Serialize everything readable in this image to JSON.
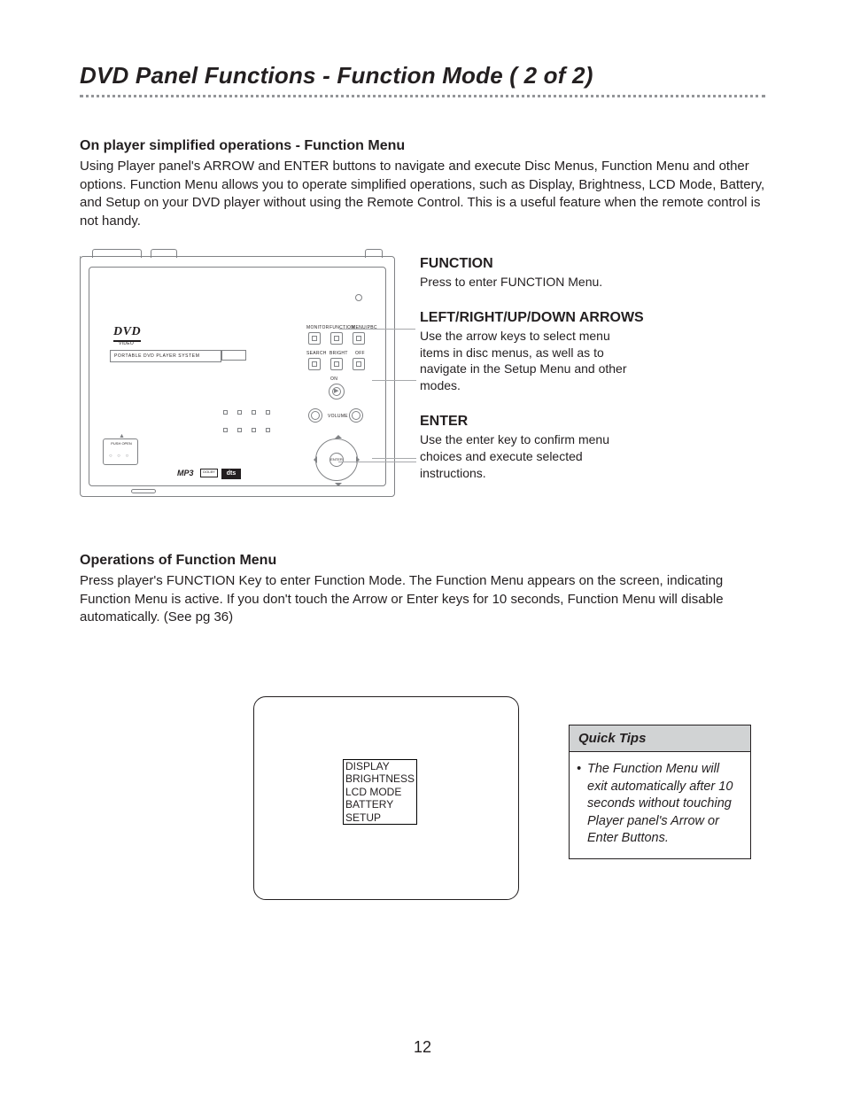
{
  "title": "DVD Panel Functions - Function Mode ( 2 of 2)",
  "section1": {
    "heading": "On player simplified operations - Function Menu",
    "body": "Using Player panel's  ARROW and ENTER buttons to navigate and execute Disc Menus, Function Menu and other options. Function Menu allows you to operate simplified operations, such as Display, Brightness, LCD Mode, Battery, and Setup on your DVD player without using the Remote Control. This is a useful feature when the remote control is not handy."
  },
  "diagram": {
    "dvd_logo": "DVD",
    "dvd_sub": "VIDEO",
    "device_label": "PORTABLE DVD PLAYER SYSTEM",
    "btn_labels_row1": [
      "MONITOR",
      "FUNCTION",
      "MENU/PBC"
    ],
    "btn_labels_row2": [
      "SEARCH",
      "BRIGHT",
      "OFF"
    ],
    "onoff": "ON",
    "volume": "VOLUME",
    "enter": "ENTER",
    "eject_label": "PUSH OPEN",
    "mp3": "MP3",
    "dolby": "DOLBY",
    "dts": "dts"
  },
  "callouts": [
    {
      "heading": "FUNCTION",
      "body": "Press to enter FUNCTION Menu."
    },
    {
      "heading": "LEFT/RIGHT/UP/DOWN ARROWS",
      "body": "Use the arrow keys to select menu items in disc menus, as well as to navigate in the Setup Menu and other modes."
    },
    {
      "heading": "ENTER",
      "body": "Use the enter key to confirm menu choices and execute selected instructions."
    }
  ],
  "section2": {
    "heading": "Operations of Function Menu",
    "body": "Press player's FUNCTION Key to enter Function Mode. The Function Menu appears on the screen, indicating Function Menu is active. If you don't touch the Arrow or Enter keys for 10 seconds, Function Menu will disable automatically. (See pg 36)"
  },
  "function_menu_items": [
    "DISPLAY",
    "BRIGHTNESS",
    "LCD MODE",
    "BATTERY",
    "SETUP"
  ],
  "quick_tips": {
    "heading": "Quick Tips",
    "items": [
      "The Function Menu will exit automatically after 10 seconds without touching Player panel's Arrow or Enter Buttons."
    ]
  },
  "page_number": "12"
}
